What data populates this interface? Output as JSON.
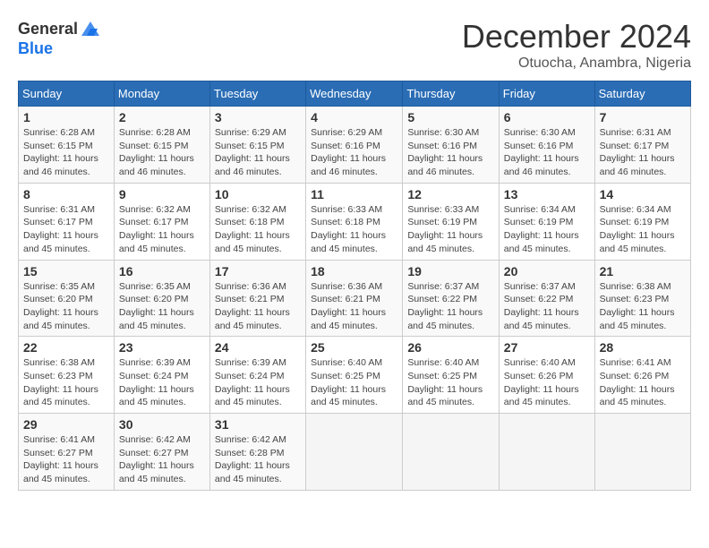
{
  "header": {
    "logo_line1": "General",
    "logo_line2": "Blue",
    "month": "December 2024",
    "location": "Otuocha, Anambra, Nigeria"
  },
  "weekdays": [
    "Sunday",
    "Monday",
    "Tuesday",
    "Wednesday",
    "Thursday",
    "Friday",
    "Saturday"
  ],
  "weeks": [
    [
      {
        "day": "1",
        "sunrise": "6:28 AM",
        "sunset": "6:15 PM",
        "daylight": "11 hours and 46 minutes."
      },
      {
        "day": "2",
        "sunrise": "6:28 AM",
        "sunset": "6:15 PM",
        "daylight": "11 hours and 46 minutes."
      },
      {
        "day": "3",
        "sunrise": "6:29 AM",
        "sunset": "6:15 PM",
        "daylight": "11 hours and 46 minutes."
      },
      {
        "day": "4",
        "sunrise": "6:29 AM",
        "sunset": "6:16 PM",
        "daylight": "11 hours and 46 minutes."
      },
      {
        "day": "5",
        "sunrise": "6:30 AM",
        "sunset": "6:16 PM",
        "daylight": "11 hours and 46 minutes."
      },
      {
        "day": "6",
        "sunrise": "6:30 AM",
        "sunset": "6:16 PM",
        "daylight": "11 hours and 46 minutes."
      },
      {
        "day": "7",
        "sunrise": "6:31 AM",
        "sunset": "6:17 PM",
        "daylight": "11 hours and 46 minutes."
      }
    ],
    [
      {
        "day": "8",
        "sunrise": "6:31 AM",
        "sunset": "6:17 PM",
        "daylight": "11 hours and 45 minutes."
      },
      {
        "day": "9",
        "sunrise": "6:32 AM",
        "sunset": "6:17 PM",
        "daylight": "11 hours and 45 minutes."
      },
      {
        "day": "10",
        "sunrise": "6:32 AM",
        "sunset": "6:18 PM",
        "daylight": "11 hours and 45 minutes."
      },
      {
        "day": "11",
        "sunrise": "6:33 AM",
        "sunset": "6:18 PM",
        "daylight": "11 hours and 45 minutes."
      },
      {
        "day": "12",
        "sunrise": "6:33 AM",
        "sunset": "6:19 PM",
        "daylight": "11 hours and 45 minutes."
      },
      {
        "day": "13",
        "sunrise": "6:34 AM",
        "sunset": "6:19 PM",
        "daylight": "11 hours and 45 minutes."
      },
      {
        "day": "14",
        "sunrise": "6:34 AM",
        "sunset": "6:19 PM",
        "daylight": "11 hours and 45 minutes."
      }
    ],
    [
      {
        "day": "15",
        "sunrise": "6:35 AM",
        "sunset": "6:20 PM",
        "daylight": "11 hours and 45 minutes."
      },
      {
        "day": "16",
        "sunrise": "6:35 AM",
        "sunset": "6:20 PM",
        "daylight": "11 hours and 45 minutes."
      },
      {
        "day": "17",
        "sunrise": "6:36 AM",
        "sunset": "6:21 PM",
        "daylight": "11 hours and 45 minutes."
      },
      {
        "day": "18",
        "sunrise": "6:36 AM",
        "sunset": "6:21 PM",
        "daylight": "11 hours and 45 minutes."
      },
      {
        "day": "19",
        "sunrise": "6:37 AM",
        "sunset": "6:22 PM",
        "daylight": "11 hours and 45 minutes."
      },
      {
        "day": "20",
        "sunrise": "6:37 AM",
        "sunset": "6:22 PM",
        "daylight": "11 hours and 45 minutes."
      },
      {
        "day": "21",
        "sunrise": "6:38 AM",
        "sunset": "6:23 PM",
        "daylight": "11 hours and 45 minutes."
      }
    ],
    [
      {
        "day": "22",
        "sunrise": "6:38 AM",
        "sunset": "6:23 PM",
        "daylight": "11 hours and 45 minutes."
      },
      {
        "day": "23",
        "sunrise": "6:39 AM",
        "sunset": "6:24 PM",
        "daylight": "11 hours and 45 minutes."
      },
      {
        "day": "24",
        "sunrise": "6:39 AM",
        "sunset": "6:24 PM",
        "daylight": "11 hours and 45 minutes."
      },
      {
        "day": "25",
        "sunrise": "6:40 AM",
        "sunset": "6:25 PM",
        "daylight": "11 hours and 45 minutes."
      },
      {
        "day": "26",
        "sunrise": "6:40 AM",
        "sunset": "6:25 PM",
        "daylight": "11 hours and 45 minutes."
      },
      {
        "day": "27",
        "sunrise": "6:40 AM",
        "sunset": "6:26 PM",
        "daylight": "11 hours and 45 minutes."
      },
      {
        "day": "28",
        "sunrise": "6:41 AM",
        "sunset": "6:26 PM",
        "daylight": "11 hours and 45 minutes."
      }
    ],
    [
      {
        "day": "29",
        "sunrise": "6:41 AM",
        "sunset": "6:27 PM",
        "daylight": "11 hours and 45 minutes."
      },
      {
        "day": "30",
        "sunrise": "6:42 AM",
        "sunset": "6:27 PM",
        "daylight": "11 hours and 45 minutes."
      },
      {
        "day": "31",
        "sunrise": "6:42 AM",
        "sunset": "6:28 PM",
        "daylight": "11 hours and 45 minutes."
      },
      null,
      null,
      null,
      null
    ]
  ]
}
